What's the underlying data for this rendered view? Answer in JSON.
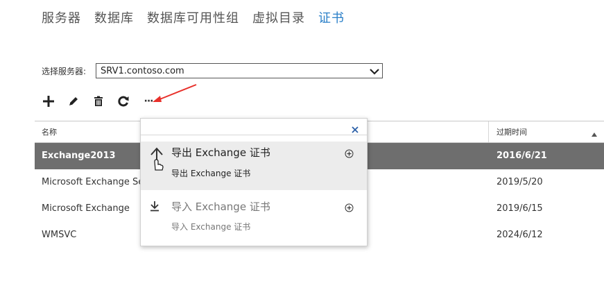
{
  "nav": {
    "tabs": [
      {
        "label": "服务器"
      },
      {
        "label": "数据库"
      },
      {
        "label": "数据库可用性组"
      },
      {
        "label": "虚拟目录"
      },
      {
        "label": "证书"
      }
    ],
    "active_tab": "证书",
    "active_color": "#2a7fc8"
  },
  "server_select": {
    "label": "选择服务器:",
    "value": "SRV1.contoso.com"
  },
  "toolbar": {
    "icons": [
      "add-icon",
      "edit-icon",
      "delete-icon",
      "refresh-icon",
      "more-icon"
    ],
    "more_label": "···"
  },
  "grid": {
    "columns": {
      "name": "名称",
      "expires": "过期时间"
    },
    "rows": [
      {
        "name": "Exchange2013",
        "expires": "2016/6/21",
        "selected": true
      },
      {
        "name": "Microsoft Exchange Se",
        "expires": "2019/5/20"
      },
      {
        "name": "Microsoft Exchange",
        "expires": "2019/6/15"
      },
      {
        "name": "WMSVC",
        "expires": "2024/6/12"
      }
    ],
    "selected_color": "#6e6e6e"
  },
  "popup": {
    "items": [
      {
        "title": "导出 Exchange 证书",
        "subtitle": "导出 Exchange 证书",
        "enabled": true,
        "icon": "export-icon"
      },
      {
        "title": "导入 Exchange 证书",
        "subtitle": "导入 Exchange 证书",
        "enabled": false,
        "icon": "import-icon"
      }
    ]
  },
  "annotation": {
    "color": "#e8302a"
  }
}
